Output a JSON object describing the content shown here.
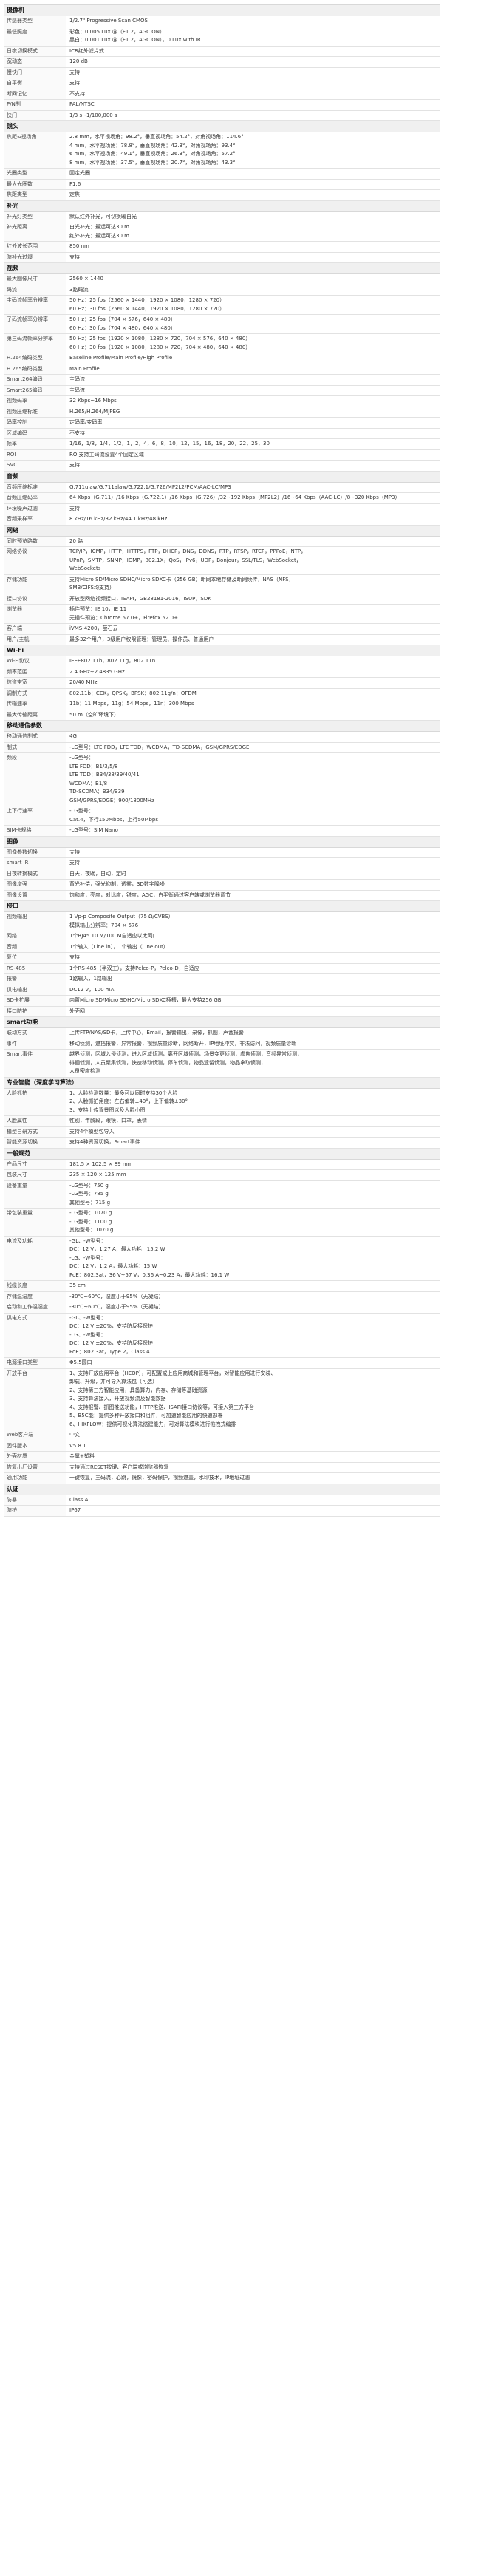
{
  "sections": [
    {
      "title": "摄像机",
      "rows": [
        {
          "k": "传感器类型",
          "v": [
            "1/2.7\" Progressive Scan CMOS"
          ]
        },
        {
          "k": "最低照度",
          "v": [
            "彩色：0.005 Lux @（F1.2，AGC ON）",
            "黑白：0.001 Lux @（F1.2，AGC ON），0 Lux with IR"
          ]
        },
        {
          "k": "日夜切换模式",
          "v": [
            "ICR红外滤片式"
          ]
        },
        {
          "k": "宽动态",
          "v": [
            "120 dB"
          ]
        },
        {
          "k": "慢快门",
          "v": [
            "支持"
          ]
        },
        {
          "k": "自平衡",
          "v": [
            "支持"
          ]
        },
        {
          "k": "断网记忆",
          "v": [
            "不支持"
          ]
        },
        {
          "k": "P/N制",
          "v": [
            "PAL/NTSC"
          ]
        },
        {
          "k": "快门",
          "v": [
            "1/3 s~1/100,000 s"
          ]
        }
      ]
    },
    {
      "title": "镜头",
      "rows": [
        {
          "k": "焦距&视场角",
          "v": [
            "2.8 mm，水平视场角：98.2°，垂直视场角：54.2°，对角视场角：114.6°",
            "4 mm，水平视场角：78.8°，垂直视场角：42.3°，对角视场角：93.4°",
            "6 mm，水平视场角：49.1°，垂直视场角：26.3°，对角视场角：57.2°",
            "8 mm，水平视场角：37.5°，垂直视场角：20.7°，对角视场角：43.3°"
          ]
        },
        {
          "k": "光圈类型",
          "v": [
            "固定光圈"
          ]
        },
        {
          "k": "最大光圈数",
          "v": [
            "F1.6"
          ]
        },
        {
          "k": "焦距类型",
          "v": [
            "定焦"
          ]
        }
      ]
    },
    {
      "title": "补光",
      "rows": [
        {
          "k": "补光灯类型",
          "v": [
            "默认红外补光，可切换暖白光"
          ]
        },
        {
          "k": "补光距离",
          "v": [
            "白光补光：最远可达30 m",
            "红外补光：最远可达30 m"
          ]
        },
        {
          "k": "红外波长范围",
          "v": [
            "850 nm"
          ]
        },
        {
          "k": "防补光过爆",
          "v": [
            "支持"
          ]
        }
      ]
    },
    {
      "title": "视频",
      "rows": [
        {
          "k": "最大图像尺寸",
          "v": [
            "2560 × 1440"
          ]
        },
        {
          "k": "码流",
          "v": [
            "3路码流"
          ]
        },
        {
          "k": "主码流帧率分辨率",
          "v": [
            "50 Hz：25 fps（2560 × 1440，1920 × 1080，1280 × 720）",
            "60 Hz：30 fps（2560 × 1440，1920 × 1080，1280 × 720）"
          ]
        },
        {
          "k": "子码流帧率分辨率",
          "v": [
            "50 Hz：25 fps（704 × 576，640 × 480）",
            "60 Hz：30 fps（704 × 480，640 × 480）"
          ]
        },
        {
          "k": "第三码流帧率分辨率",
          "v": [
            "50 Hz：25 fps（1920 × 1080，1280 × 720，704 × 576，640 × 480）",
            "60 Hz：30 fps（1920 × 1080，1280 × 720，704 × 480，640 × 480）"
          ]
        },
        {
          "k": "H.264编码类型",
          "v": [
            "Baseline Profile/Main Profile/High Profile"
          ]
        },
        {
          "k": "H.265编码类型",
          "v": [
            "Main Profile"
          ]
        },
        {
          "k": "Smart264编码",
          "v": [
            "主码流"
          ]
        },
        {
          "k": "Smart265编码",
          "v": [
            "主码流"
          ]
        },
        {
          "k": "视频码率",
          "v": [
            "32 Kbps~16 Mbps"
          ]
        },
        {
          "k": "视频压缩标准",
          "v": [
            "H.265/H.264/MJPEG"
          ]
        },
        {
          "k": "码率控制",
          "v": [
            "定码率/变码率"
          ]
        },
        {
          "k": "区域编码",
          "v": [
            "不支持"
          ]
        },
        {
          "k": "帧率",
          "v": [
            "1/16，1/8，1/4，1/2，1，2，4，6，8，10，12，15，16，18，20，22，25，30"
          ]
        },
        {
          "k": "ROI",
          "v": [
            "ROI支持主码流设置4个固定区域"
          ]
        },
        {
          "k": "SVC",
          "v": [
            "支持"
          ]
        }
      ]
    },
    {
      "title": "音频",
      "rows": [
        {
          "k": "音频压缩标准",
          "v": [
            "G.711ulaw/G.711alaw/G.722.1/G.726/MP2L2/PCM/AAC-LC/MP3"
          ]
        },
        {
          "k": "音频压缩码率",
          "v": [
            "64 Kbps（G.711）/16 Kbps（G.722.1）/16 Kbps（G.726）/32~192 Kbps（MP2L2）/16~64 Kbps（AAC-LC）/8~320 Kbps（MP3）"
          ]
        },
        {
          "k": "环境噪声过滤",
          "v": [
            "支持"
          ]
        },
        {
          "k": "音频采样率",
          "v": [
            "8 kHz/16 kHz/32 kHz/44.1 kHz/48 kHz"
          ]
        }
      ]
    },
    {
      "title": "网络",
      "rows": [
        {
          "k": "同时预览路数",
          "v": [
            "20 路"
          ]
        },
        {
          "k": "网络协议",
          "v": [
            "TCP/IP，ICMP，HTTP，HTTPS，FTP，DHCP，DNS，DDNS，RTP，RTSP，RTCP，PPPoE，NTP，",
            "UPnP，SMTP，SNMP，IGMP，802.1X，QoS，IPv6，UDP，Bonjour，SSL/TLS，WebSocket，",
            "WebSockets"
          ]
        },
        {
          "k": "存储功能",
          "v": [
            "支持Micro SD/Micro SDHC/Micro SDXC卡（256 GB）断网本地存储及断网续传，NAS（NFS，",
            "SMB/CIFS均支持）"
          ]
        },
        {
          "k": "接口协议",
          "v": [
            "开放型网络视频接口，ISAPI，GB28181-2016，ISUP，SDK"
          ]
        },
        {
          "k": "浏览器",
          "v": [
            "插件预览：IE 10，IE 11",
            "无插件预览：Chrome 57.0+，Firefox 52.0+"
          ]
        },
        {
          "k": "客户端",
          "v": [
            "iVMS-4200，萤石云"
          ]
        },
        {
          "k": "用户/主机",
          "v": [
            "最多32个用户，3级用户权限管理：管理员、操作员、普通用户"
          ]
        }
      ]
    },
    {
      "title": "Wi-Fi",
      "rows": [
        {
          "k": "Wi-Fi协议",
          "v": [
            "IEEE802.11b，802.11g，802.11n"
          ]
        },
        {
          "k": "频率范围",
          "v": [
            "2.4 GHz~2.4835 GHz"
          ]
        },
        {
          "k": "信道带宽",
          "v": [
            "20/40 MHz"
          ]
        },
        {
          "k": "调制方式",
          "v": [
            "802.11b：CCK，QPSK，BPSK；802.11g/n：OFDM"
          ]
        },
        {
          "k": "传输速率",
          "v": [
            "11b：11 Mbps，11g：54 Mbps，11n：300 Mbps"
          ]
        },
        {
          "k": "最大传输距离",
          "v": [
            "50 m（空旷环境下）"
          ]
        }
      ]
    },
    {
      "title": "移动通信参数",
      "rows": [
        {
          "k": "移动通信制式",
          "v": [
            "4G"
          ]
        },
        {
          "k": "制式",
          "v": [
            "-LG型号：LTE FDD，LTE TDD，WCDMA，TD-SCDMA，GSM/GPRS/EDGE"
          ]
        },
        {
          "k": "频段",
          "v": [
            "-LG型号：",
            "LTE FDD：B1/3/5/8",
            "LTE TDD：B34/38/39/40/41",
            "WCDMA：B1/8",
            "TD-SCDMA：B34/B39",
            "GSM/GPRS/EDGE：900/1800MHz"
          ]
        },
        {
          "k": "上下行速率",
          "v": [
            "-LG型号：",
            "Cat.4，下行150Mbps，上行50Mbps"
          ]
        },
        {
          "k": "SIM卡规格",
          "v": [
            "-LG型号：SIM Nano"
          ]
        }
      ]
    },
    {
      "title": "图像",
      "rows": [
        {
          "k": "图像参数切换",
          "v": [
            "支持"
          ]
        },
        {
          "k": "smart IR",
          "v": [
            "支持"
          ]
        },
        {
          "k": "日夜转换模式",
          "v": [
            "白天，夜晚，自动，定时"
          ]
        },
        {
          "k": "图像增强",
          "v": [
            "背光补偿，强光抑制，透雾，3D数字降噪"
          ]
        },
        {
          "k": "图像设置",
          "v": [
            "饱和度，亮度，对比度，锐度，AGC，白平衡通过客户端或浏览器调节"
          ]
        }
      ]
    },
    {
      "title": "接口",
      "rows": [
        {
          "k": "视频输出",
          "v": [
            "1 Vp-p Composite Output（75 Ω/CVBS）",
            "模拟输出分辨率：704 × 576"
          ]
        },
        {
          "k": "网络",
          "v": [
            "1个RJ45 10 M/100 M自适应以太网口"
          ]
        },
        {
          "k": "音频",
          "v": [
            "1个输入（Line in），1个输出（Line out）"
          ]
        },
        {
          "k": "复位",
          "v": [
            "支持"
          ]
        },
        {
          "k": "RS-485",
          "v": [
            "1个RS-485（半双工），支持Pelco-P，Pelco-D，自适应"
          ]
        },
        {
          "k": "报警",
          "v": [
            "1路输入，1路输出"
          ]
        },
        {
          "k": "供电输出",
          "v": [
            "DC12 V，100 mA"
          ]
        },
        {
          "k": "SD卡扩展",
          "v": [
            "内置Micro SD/Micro SDHC/Micro SDXC插槽，最大支持256 GB"
          ]
        },
        {
          "k": "接口防护",
          "v": [
            "外壳网"
          ]
        }
      ]
    },
    {
      "title": "smart功能",
      "rows": [
        {
          "k": "联动方式",
          "v": [
            "上传FTP/NAS/SD卡，上传中心，Email，报警输出，录像，抓图，声音报警"
          ]
        },
        {
          "k": "事件",
          "v": [
            "移动侦测，遮挡报警，异常报警，视频质量诊断，网络断开，IP地址冲突，非法访问，视频质量诊断"
          ]
        },
        {
          "k": "Smart事件",
          "v": [
            "越界侦测，区域入侵侦测，进入区域侦测，离开区域侦测，场景变更侦测，虚焦侦测，音频异常侦测，",
            "徘徊侦测，人员聚集侦测，快速移动侦测，停车侦测，物品遗留侦测，物品拿取侦测，",
            "人员密度检测"
          ]
        }
      ]
    },
    {
      "title": "专业智能（深度学习算法）",
      "rows": [
        {
          "k": "人脸抓拍",
          "v": [
            "1、人脸检测数量：最多可以同时支持30个人脸",
            "2、人脸抓拍角度：左右偏转±40°，上下偏转±30°",
            "3、支持上传背景图以及人脸小图"
          ]
        },
        {
          "k": "人脸属性",
          "v": [
            "性别，年龄段，眼镜，口罩，表情"
          ]
        },
        {
          "k": "模型自研方式",
          "v": [
            "支持4个模型包导入"
          ]
        },
        {
          "k": "智能资源切换",
          "v": [
            "支持4种资源切换，Smart事件"
          ]
        }
      ]
    },
    {
      "title": "一般规范",
      "rows": [
        {
          "k": "产品尺寸",
          "v": [
            "181.5 × 102.5 × 89 mm"
          ]
        },
        {
          "k": "包装尺寸",
          "v": [
            "235 × 120 × 125 mm"
          ]
        },
        {
          "k": "设备重量",
          "v": [
            "-LG型号：750 g",
            "-LG型号：785 g",
            "其他型号：715 g"
          ]
        },
        {
          "k": "带包装重量",
          "v": [
            "-LG型号：1070 g",
            "-LG型号：1100 g",
            "其他型号：1070 g"
          ]
        },
        {
          "k": "电流及功耗",
          "v": [
            "-GL、-W型号：",
            "DC：12 V，1.27 A，最大功耗：15.2 W",
            "-LG、-W型号：",
            "DC：12 V，1.2 A，最大功耗：15 W",
            "PoE：802.3at，36 V~57 V，0.36 A~0.23 A，最大功耗：16.1 W"
          ]
        },
        {
          "k": "线缆长度",
          "v": [
            "35 cm"
          ]
        },
        {
          "k": "存储温湿度",
          "v": [
            "-30℃~60℃，湿度小于95%（无凝结）"
          ]
        },
        {
          "k": "启动和工作温湿度",
          "v": [
            "-30℃~60℃，湿度小于95%（无凝结）"
          ]
        },
        {
          "k": "供电方式",
          "v": [
            "-GL、-W型号：",
            "DC：12 V ±20%，支持防反接保护",
            "-LG、-W型号：",
            "DC：12 V ±20%，支持防反接保护",
            "PoE：802.3at，Type 2，Class 4"
          ]
        },
        {
          "k": "电源接口类型",
          "v": [
            "Φ5.5圆口"
          ]
        },
        {
          "k": "开放平台",
          "v": [
            "1、支持开放应用平台（HEOP），可配置或上应用商城和管理平台，对智能应用进行安装、",
            "卸载、升级，并可导入算法包（可选）",
            "2、支持第三方智能应用，具备算力，内存、存储等基础资源",
            "3、支持算法接入，开放视频流及智能数据",
            "4、支持报警、抓图推送功能，HTTP推送、ISAPI接口协议等，可接入第三方平台",
            "5、B5C能：提供多种开放接口和组件，可加速智能应用的快速部署",
            "6、HIKFLOW：提供可视化算法搭建能力，可对算法模块进行拖拽式编排"
          ]
        },
        {
          "k": "Web客户端",
          "v": [
            "中文"
          ]
        },
        {
          "k": "固件版本",
          "v": [
            "V5.8.1"
          ]
        },
        {
          "k": "外壳材质",
          "v": [
            "金属+塑料"
          ]
        },
        {
          "k": "恢复出厂设置",
          "v": [
            "支持通过RESET按键、客户端或浏览器恢复"
          ]
        },
        {
          "k": "通用功能",
          "v": [
            "一键恢复，三码流，心跳，镜像，密码保护，视频遮盖，水印技术，IP地址过滤"
          ]
        }
      ]
    },
    {
      "title": "认证",
      "rows": [
        {
          "k": "防暴",
          "v": [
            "Class A"
          ]
        },
        {
          "k": "防护",
          "v": [
            "IP67"
          ]
        }
      ]
    }
  ]
}
